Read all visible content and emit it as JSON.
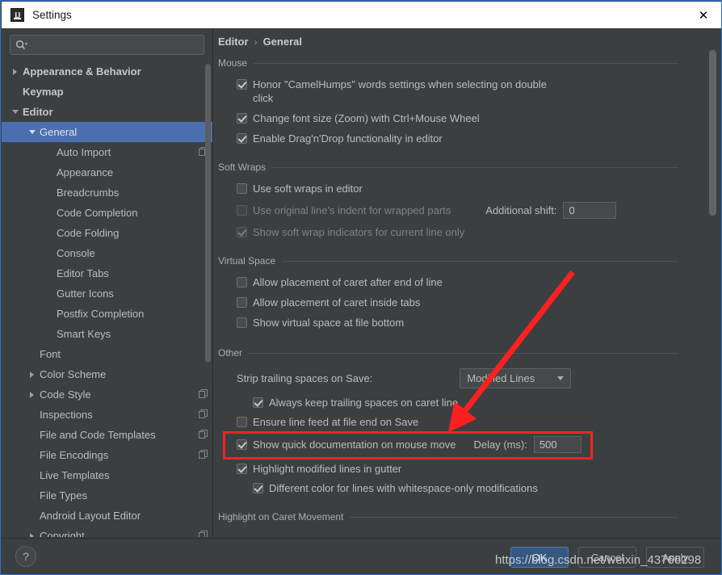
{
  "window": {
    "title": "Settings",
    "logo_text": "IJ",
    "close_label": "✕"
  },
  "sidebar": {
    "search": {
      "value": "",
      "placeholder": ""
    },
    "items": [
      {
        "label": "Appearance & Behavior",
        "indent": 0,
        "twisty": "right",
        "bold": true,
        "selected": false,
        "copyable": false
      },
      {
        "label": "Keymap",
        "indent": 0,
        "twisty": "none",
        "bold": true,
        "selected": false,
        "copyable": false
      },
      {
        "label": "Editor",
        "indent": 0,
        "twisty": "down",
        "bold": true,
        "selected": false,
        "copyable": false
      },
      {
        "label": "General",
        "indent": 1,
        "twisty": "down",
        "bold": false,
        "selected": true,
        "copyable": false
      },
      {
        "label": "Auto Import",
        "indent": 2,
        "twisty": "none",
        "bold": false,
        "selected": false,
        "copyable": true
      },
      {
        "label": "Appearance",
        "indent": 2,
        "twisty": "none",
        "bold": false,
        "selected": false,
        "copyable": false
      },
      {
        "label": "Breadcrumbs",
        "indent": 2,
        "twisty": "none",
        "bold": false,
        "selected": false,
        "copyable": false
      },
      {
        "label": "Code Completion",
        "indent": 2,
        "twisty": "none",
        "bold": false,
        "selected": false,
        "copyable": false
      },
      {
        "label": "Code Folding",
        "indent": 2,
        "twisty": "none",
        "bold": false,
        "selected": false,
        "copyable": false
      },
      {
        "label": "Console",
        "indent": 2,
        "twisty": "none",
        "bold": false,
        "selected": false,
        "copyable": false
      },
      {
        "label": "Editor Tabs",
        "indent": 2,
        "twisty": "none",
        "bold": false,
        "selected": false,
        "copyable": false
      },
      {
        "label": "Gutter Icons",
        "indent": 2,
        "twisty": "none",
        "bold": false,
        "selected": false,
        "copyable": false
      },
      {
        "label": "Postfix Completion",
        "indent": 2,
        "twisty": "none",
        "bold": false,
        "selected": false,
        "copyable": false
      },
      {
        "label": "Smart Keys",
        "indent": 2,
        "twisty": "none",
        "bold": false,
        "selected": false,
        "copyable": false
      },
      {
        "label": "Font",
        "indent": 1,
        "twisty": "none",
        "bold": false,
        "selected": false,
        "copyable": false
      },
      {
        "label": "Color Scheme",
        "indent": 1,
        "twisty": "right",
        "bold": false,
        "selected": false,
        "copyable": false
      },
      {
        "label": "Code Style",
        "indent": 1,
        "twisty": "right",
        "bold": false,
        "selected": false,
        "copyable": true
      },
      {
        "label": "Inspections",
        "indent": 1,
        "twisty": "none",
        "bold": false,
        "selected": false,
        "copyable": true
      },
      {
        "label": "File and Code Templates",
        "indent": 1,
        "twisty": "none",
        "bold": false,
        "selected": false,
        "copyable": true
      },
      {
        "label": "File Encodings",
        "indent": 1,
        "twisty": "none",
        "bold": false,
        "selected": false,
        "copyable": true
      },
      {
        "label": "Live Templates",
        "indent": 1,
        "twisty": "none",
        "bold": false,
        "selected": false,
        "copyable": false
      },
      {
        "label": "File Types",
        "indent": 1,
        "twisty": "none",
        "bold": false,
        "selected": false,
        "copyable": false
      },
      {
        "label": "Android Layout Editor",
        "indent": 1,
        "twisty": "none",
        "bold": false,
        "selected": false,
        "copyable": false
      },
      {
        "label": "Copyright",
        "indent": 1,
        "twisty": "right",
        "bold": false,
        "selected": false,
        "copyable": true
      }
    ]
  },
  "breadcrumb": {
    "root": "Editor",
    "separator": "›",
    "leaf": "General"
  },
  "groups": {
    "mouse": {
      "title": "Mouse",
      "options": [
        {
          "label": "Honor \"CamelHumps\" words settings when selecting on double click",
          "checked": true,
          "enabled": true
        },
        {
          "label": "Change font size (Zoom) with Ctrl+Mouse Wheel",
          "checked": true,
          "enabled": true
        },
        {
          "label": "Enable Drag'n'Drop functionality in editor",
          "checked": true,
          "enabled": true
        }
      ]
    },
    "soft_wraps": {
      "title": "Soft Wraps",
      "options": [
        {
          "label": "Use soft wraps in editor",
          "checked": false,
          "enabled": true
        },
        {
          "label": "Use original line's indent for wrapped parts",
          "checked": false,
          "enabled": false
        },
        {
          "label": "Show soft wrap indicators for current line only",
          "checked": true,
          "enabled": false
        }
      ],
      "additional_shift": {
        "label": "Additional shift:",
        "value": "0"
      }
    },
    "virtual_space": {
      "title": "Virtual Space",
      "options": [
        {
          "label": "Allow placement of caret after end of line",
          "checked": false,
          "enabled": true
        },
        {
          "label": "Allow placement of caret inside tabs",
          "checked": false,
          "enabled": true
        },
        {
          "label": "Show virtual space at file bottom",
          "checked": false,
          "enabled": true
        }
      ]
    },
    "other": {
      "title": "Other",
      "strip_label": "Strip trailing spaces on Save:",
      "strip_value": "Modified Lines",
      "delay_label": "Delay (ms):",
      "delay_value": "500",
      "options": [
        {
          "label": "Always keep trailing spaces on caret line",
          "checked": true,
          "enabled": true
        },
        {
          "label": "Ensure line feed at file end on Save",
          "checked": false,
          "enabled": true
        },
        {
          "label": "Show quick documentation on mouse move",
          "checked": true,
          "enabled": true
        },
        {
          "label": "Highlight modified lines in gutter",
          "checked": true,
          "enabled": true
        },
        {
          "label": "Different color for lines with whitespace-only modifications",
          "checked": true,
          "enabled": true
        }
      ]
    },
    "highlight_caret": {
      "title": "Highlight on Caret Movement"
    }
  },
  "footer": {
    "help_label": "?",
    "ok_label": "OK",
    "cancel_label": "Cancel",
    "apply_label": "Apply"
  },
  "annotation": {
    "watermark": "https://blog.csdn.net/weixin_43766298",
    "highlight_color": "#fc2020"
  }
}
